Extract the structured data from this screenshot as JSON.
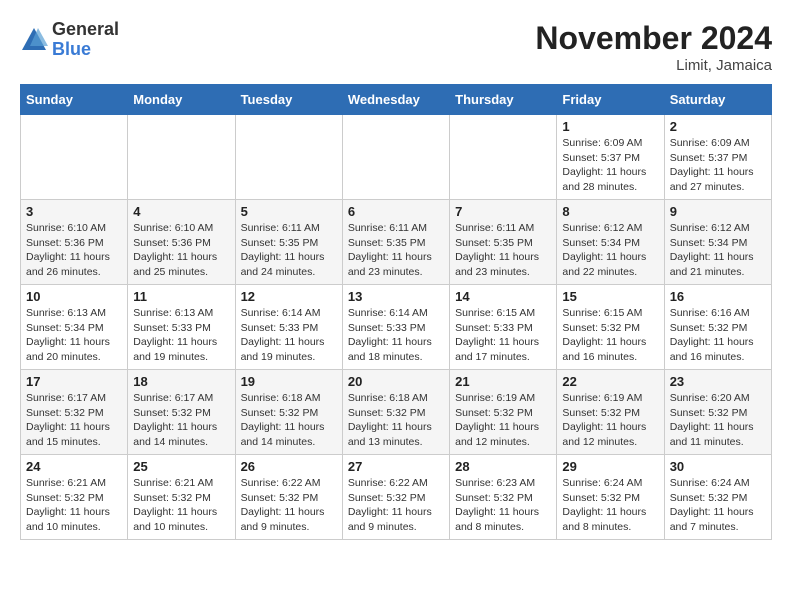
{
  "header": {
    "logo_general": "General",
    "logo_blue": "Blue",
    "month_title": "November 2024",
    "location": "Limit, Jamaica"
  },
  "days_of_week": [
    "Sunday",
    "Monday",
    "Tuesday",
    "Wednesday",
    "Thursday",
    "Friday",
    "Saturday"
  ],
  "weeks": [
    [
      {
        "day": "",
        "detail": ""
      },
      {
        "day": "",
        "detail": ""
      },
      {
        "day": "",
        "detail": ""
      },
      {
        "day": "",
        "detail": ""
      },
      {
        "day": "",
        "detail": ""
      },
      {
        "day": "1",
        "detail": "Sunrise: 6:09 AM\nSunset: 5:37 PM\nDaylight: 11 hours and 28 minutes."
      },
      {
        "day": "2",
        "detail": "Sunrise: 6:09 AM\nSunset: 5:37 PM\nDaylight: 11 hours and 27 minutes."
      }
    ],
    [
      {
        "day": "3",
        "detail": "Sunrise: 6:10 AM\nSunset: 5:36 PM\nDaylight: 11 hours and 26 minutes."
      },
      {
        "day": "4",
        "detail": "Sunrise: 6:10 AM\nSunset: 5:36 PM\nDaylight: 11 hours and 25 minutes."
      },
      {
        "day": "5",
        "detail": "Sunrise: 6:11 AM\nSunset: 5:35 PM\nDaylight: 11 hours and 24 minutes."
      },
      {
        "day": "6",
        "detail": "Sunrise: 6:11 AM\nSunset: 5:35 PM\nDaylight: 11 hours and 23 minutes."
      },
      {
        "day": "7",
        "detail": "Sunrise: 6:11 AM\nSunset: 5:35 PM\nDaylight: 11 hours and 23 minutes."
      },
      {
        "day": "8",
        "detail": "Sunrise: 6:12 AM\nSunset: 5:34 PM\nDaylight: 11 hours and 22 minutes."
      },
      {
        "day": "9",
        "detail": "Sunrise: 6:12 AM\nSunset: 5:34 PM\nDaylight: 11 hours and 21 minutes."
      }
    ],
    [
      {
        "day": "10",
        "detail": "Sunrise: 6:13 AM\nSunset: 5:34 PM\nDaylight: 11 hours and 20 minutes."
      },
      {
        "day": "11",
        "detail": "Sunrise: 6:13 AM\nSunset: 5:33 PM\nDaylight: 11 hours and 19 minutes."
      },
      {
        "day": "12",
        "detail": "Sunrise: 6:14 AM\nSunset: 5:33 PM\nDaylight: 11 hours and 19 minutes."
      },
      {
        "day": "13",
        "detail": "Sunrise: 6:14 AM\nSunset: 5:33 PM\nDaylight: 11 hours and 18 minutes."
      },
      {
        "day": "14",
        "detail": "Sunrise: 6:15 AM\nSunset: 5:33 PM\nDaylight: 11 hours and 17 minutes."
      },
      {
        "day": "15",
        "detail": "Sunrise: 6:15 AM\nSunset: 5:32 PM\nDaylight: 11 hours and 16 minutes."
      },
      {
        "day": "16",
        "detail": "Sunrise: 6:16 AM\nSunset: 5:32 PM\nDaylight: 11 hours and 16 minutes."
      }
    ],
    [
      {
        "day": "17",
        "detail": "Sunrise: 6:17 AM\nSunset: 5:32 PM\nDaylight: 11 hours and 15 minutes."
      },
      {
        "day": "18",
        "detail": "Sunrise: 6:17 AM\nSunset: 5:32 PM\nDaylight: 11 hours and 14 minutes."
      },
      {
        "day": "19",
        "detail": "Sunrise: 6:18 AM\nSunset: 5:32 PM\nDaylight: 11 hours and 14 minutes."
      },
      {
        "day": "20",
        "detail": "Sunrise: 6:18 AM\nSunset: 5:32 PM\nDaylight: 11 hours and 13 minutes."
      },
      {
        "day": "21",
        "detail": "Sunrise: 6:19 AM\nSunset: 5:32 PM\nDaylight: 11 hours and 12 minutes."
      },
      {
        "day": "22",
        "detail": "Sunrise: 6:19 AM\nSunset: 5:32 PM\nDaylight: 11 hours and 12 minutes."
      },
      {
        "day": "23",
        "detail": "Sunrise: 6:20 AM\nSunset: 5:32 PM\nDaylight: 11 hours and 11 minutes."
      }
    ],
    [
      {
        "day": "24",
        "detail": "Sunrise: 6:21 AM\nSunset: 5:32 PM\nDaylight: 11 hours and 10 minutes."
      },
      {
        "day": "25",
        "detail": "Sunrise: 6:21 AM\nSunset: 5:32 PM\nDaylight: 11 hours and 10 minutes."
      },
      {
        "day": "26",
        "detail": "Sunrise: 6:22 AM\nSunset: 5:32 PM\nDaylight: 11 hours and 9 minutes."
      },
      {
        "day": "27",
        "detail": "Sunrise: 6:22 AM\nSunset: 5:32 PM\nDaylight: 11 hours and 9 minutes."
      },
      {
        "day": "28",
        "detail": "Sunrise: 6:23 AM\nSunset: 5:32 PM\nDaylight: 11 hours and 8 minutes."
      },
      {
        "day": "29",
        "detail": "Sunrise: 6:24 AM\nSunset: 5:32 PM\nDaylight: 11 hours and 8 minutes."
      },
      {
        "day": "30",
        "detail": "Sunrise: 6:24 AM\nSunset: 5:32 PM\nDaylight: 11 hours and 7 minutes."
      }
    ]
  ]
}
